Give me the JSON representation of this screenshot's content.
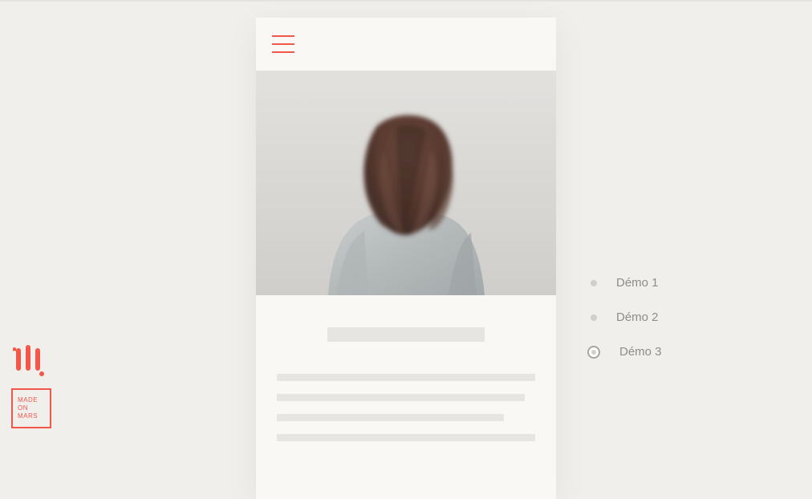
{
  "brand": {
    "line1": "MADE",
    "line2": "ON",
    "line3": "MARS"
  },
  "nav": {
    "items": [
      {
        "label": "Démo 1",
        "active": false
      },
      {
        "label": "Démo 2",
        "active": false
      },
      {
        "label": "Démo 3",
        "active": true
      }
    ]
  },
  "colors": {
    "accent": "#F25749",
    "bg": "#F1EFEC",
    "muted": "#8F8C87"
  }
}
